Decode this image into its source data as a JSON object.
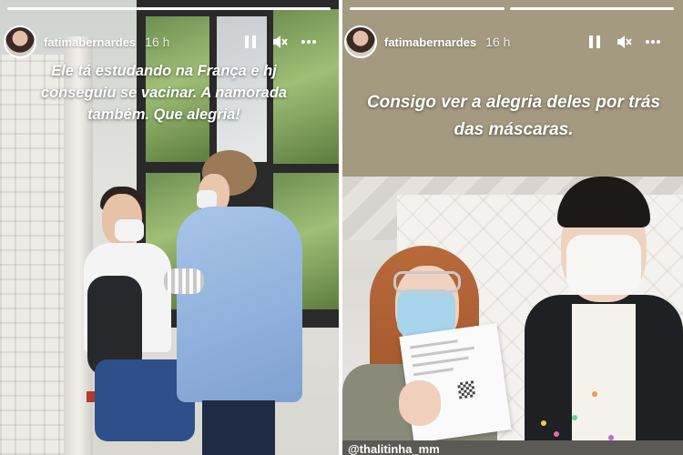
{
  "left_story": {
    "username": "fatimabernardes",
    "time": "16 h",
    "caption": "Ele tá estudando na França e hj conseguiu se vacinar. A namorada também. Que alegria!"
  },
  "right_story": {
    "username": "fatimabernardes",
    "time": "16 h",
    "caption": "Consigo ver a alegria deles por trás das máscaras.",
    "tag": "@thalitinha_mm"
  },
  "icons": {
    "pause": "pause-icon",
    "mute": "speaker-muted-icon",
    "more": "more-options-icon"
  },
  "colors": {
    "banner_background": "#a39a80",
    "text": "#ffffff",
    "progress_track": "rgba(255,255,255,0.45)",
    "progress_fill": "#ffffff"
  }
}
